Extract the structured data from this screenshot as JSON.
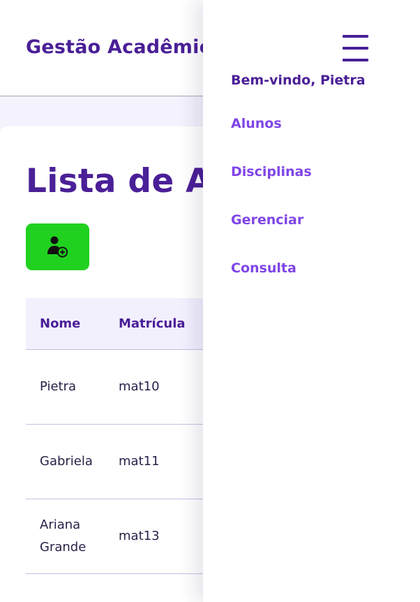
{
  "header": {
    "app_title": "Gestão Acadêmica"
  },
  "main": {
    "page_title": "Lista de Alunos",
    "add_button_icon": "add-user-icon",
    "table": {
      "columns": [
        "Nome",
        "Matrícula"
      ],
      "rows": [
        [
          "Pietra",
          "mat10"
        ],
        [
          "Gabriela",
          "mat11"
        ],
        [
          "Ariana Grande",
          "mat13"
        ]
      ]
    }
  },
  "drawer": {
    "toggle_icon": "hamburger-menu-icon",
    "welcome": "Bem-vindo, Pietra",
    "nav": [
      "Alunos",
      "Disciplinas",
      "Gerenciar",
      "Consulta"
    ]
  },
  "colors": {
    "brand": "#4a1f97",
    "accent": "#7f45e6",
    "add_button": "#21d11f",
    "table_header_bg": "#f3f0fe",
    "page_bg": "#f4f2fc"
  }
}
